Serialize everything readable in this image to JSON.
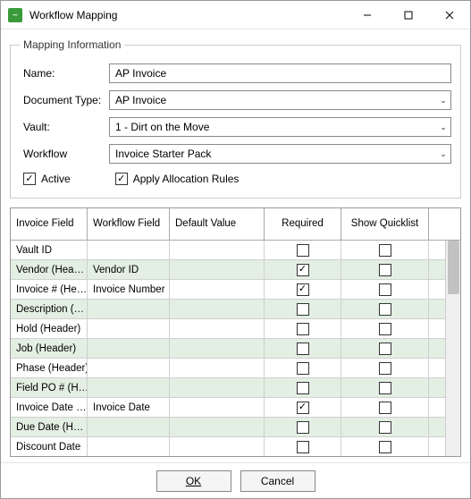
{
  "window": {
    "title": "Workflow Mapping"
  },
  "section": {
    "legend": "Mapping Information",
    "name_label": "Name:",
    "name_value": "AP Invoice",
    "doc_type_label": "Document Type:",
    "doc_type_value": "AP Invoice",
    "vault_label": "Vault:",
    "vault_value": "1 - Dirt on the Move",
    "workflow_label": "Workflow",
    "workflow_value": "Invoice Starter Pack",
    "active_label": "Active",
    "active_checked": true,
    "apply_rules_label": "Apply Allocation Rules",
    "apply_rules_checked": true
  },
  "grid": {
    "headers": {
      "invoice_field": "Invoice Field",
      "workflow_field": "Workflow Field",
      "default_value": "Default Value",
      "required": "Required",
      "show_quicklist": "Show Quicklist"
    },
    "rows": [
      {
        "inv": "Vault ID",
        "wf": "",
        "def": "",
        "req": false,
        "sq": false,
        "alt": false
      },
      {
        "inv": "Vendor  (Hea…",
        "wf": "Vendor ID",
        "def": "",
        "req": true,
        "sq": false,
        "alt": true
      },
      {
        "inv": "Invoice #  (He…",
        "wf": "Invoice Number",
        "def": "",
        "req": true,
        "sq": false,
        "alt": false
      },
      {
        "inv": "Description  (…",
        "wf": "",
        "def": "",
        "req": false,
        "sq": false,
        "alt": true
      },
      {
        "inv": "Hold  (Header)",
        "wf": "",
        "def": "",
        "req": false,
        "sq": false,
        "alt": false
      },
      {
        "inv": "Job  (Header)",
        "wf": "",
        "def": "",
        "req": false,
        "sq": false,
        "alt": true
      },
      {
        "inv": "Phase  (Header)",
        "wf": "",
        "def": "",
        "req": false,
        "sq": false,
        "alt": false
      },
      {
        "inv": "Field PO #  (H…",
        "wf": "",
        "def": "",
        "req": false,
        "sq": false,
        "alt": true
      },
      {
        "inv": "Invoice Date  …",
        "wf": "Invoice Date",
        "def": "",
        "req": true,
        "sq": false,
        "alt": false
      },
      {
        "inv": "Due Date  (H…",
        "wf": "",
        "def": "",
        "req": false,
        "sq": false,
        "alt": true
      },
      {
        "inv": "Discount Date",
        "wf": "",
        "def": "",
        "req": false,
        "sq": false,
        "alt": false
      }
    ]
  },
  "buttons": {
    "ok": "OK",
    "cancel": "Cancel"
  }
}
